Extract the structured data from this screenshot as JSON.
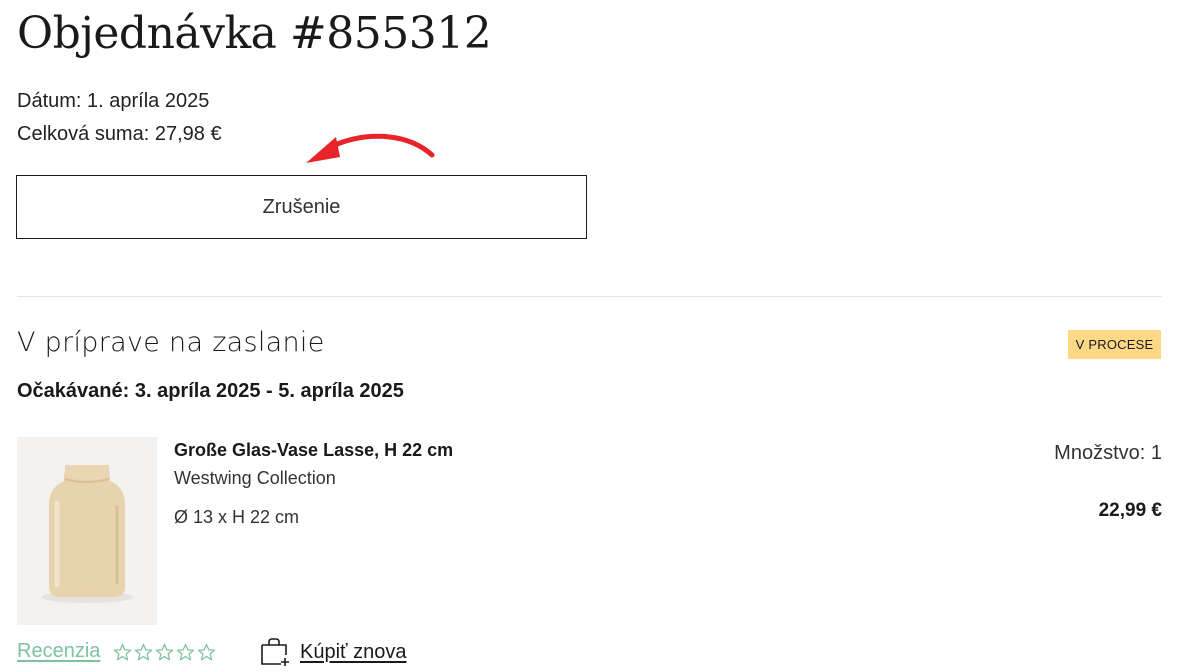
{
  "order": {
    "title": "Objednávka #855312",
    "date": "Dátum: 1. apríla 2025",
    "total": "Celková suma: 27,98 €",
    "cancel_label": "Zrušenie"
  },
  "shipment": {
    "title": "V príprave na zaslanie",
    "status": "V PROCESE",
    "expected": "Očakávané: 3. apríla 2025 - 5. apríla 2025"
  },
  "product": {
    "name": "Große Glas-Vase Lasse, H 22 cm",
    "brand": "Westwing Collection",
    "dimensions": "Ø 13 x H 22 cm",
    "quantity": "Množstvo: 1",
    "price": "22,99 €",
    "image_icon": "glass-vase-image"
  },
  "actions": {
    "review_label": "Recenzia",
    "rating_stars": 5,
    "rating_value": 0,
    "buy_again_label": "Kúpiť znova",
    "buy_again_icon": "bag-plus-icon"
  },
  "colors": {
    "badge": "#fdd886",
    "review_link": "#7cc2a2",
    "annotation_arrow": "#e8232a"
  }
}
